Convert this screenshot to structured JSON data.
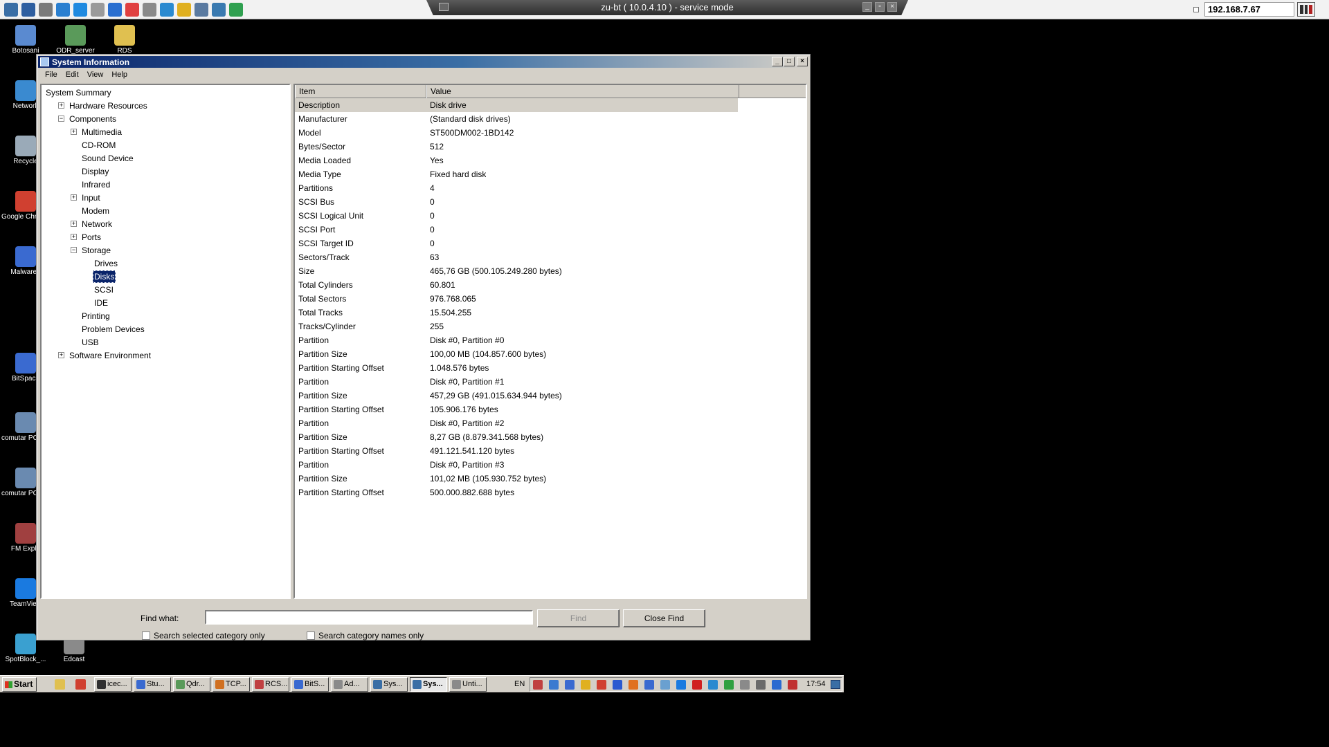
{
  "remote": {
    "title": "zu-bt ( 10.0.4.10 ) - service mode",
    "ip": "192.168.7.67",
    "tools": [
      {
        "icon": "settings-cogs-icon",
        "color": "#3a6ea5"
      },
      {
        "icon": "fullscreen-icon",
        "color": "#2f5fa0"
      },
      {
        "icon": "gear-icon",
        "color": "#7a7a7a"
      },
      {
        "icon": "refresh-icon",
        "color": "#2a7fd0"
      },
      {
        "icon": "windows-logo-icon",
        "color": "#1f8ae0"
      },
      {
        "icon": "document-icon",
        "color": "#9a9a9a"
      },
      {
        "icon": "info-icon",
        "color": "#2a6fd0"
      },
      {
        "icon": "close-circle-icon",
        "color": "#e04040"
      },
      {
        "icon": "clipboard-icon",
        "color": "#8a8a8a"
      },
      {
        "icon": "monitor-icon",
        "color": "#2a8ad0"
      },
      {
        "icon": "notes-icon",
        "color": "#e0b020"
      },
      {
        "icon": "screenshot-icon",
        "color": "#5a7aa0"
      },
      {
        "icon": "remote-settings-icon",
        "color": "#3a7ab0"
      },
      {
        "icon": "chat-icon",
        "color": "#30a050"
      }
    ]
  },
  "desktop": {
    "icons": [
      {
        "label": "Botosani",
        "color": "#5a8ad0"
      },
      {
        "label": "ODR_server",
        "color": "#5a9a5a"
      },
      {
        "label": "RDS",
        "color": "#e0c050"
      },
      {
        "label": "Network",
        "color": "#3a8ad0"
      },
      {
        "label": "Recycle",
        "color": "#9aaab8"
      },
      {
        "label": "Google Chrome",
        "color": "#d04030"
      },
      {
        "label": "Malwareb",
        "color": "#3a6ad0"
      },
      {
        "label": "BitSpace",
        "color": "#3a6ad0"
      },
      {
        "label": "comutar PC_OFF.b",
        "color": "#6a8ab0"
      },
      {
        "label": "comutar PC_ON.b",
        "color": "#6a8ab0"
      },
      {
        "label": "FM Explo",
        "color": "#a04040"
      },
      {
        "label": "TeamView",
        "color": "#1a7ae0"
      },
      {
        "label": "SpotBlock_...",
        "color": "#3aa0d0"
      },
      {
        "label": "Edcast",
        "color": "#8a8a8a"
      }
    ]
  },
  "window": {
    "title": "System Information",
    "menu": [
      "File",
      "Edit",
      "View",
      "Help"
    ],
    "tree": [
      {
        "label": "System Summary",
        "level": 0,
        "toggle": ""
      },
      {
        "label": "Hardware Resources",
        "level": 1,
        "toggle": "+"
      },
      {
        "label": "Components",
        "level": 1,
        "toggle": "−"
      },
      {
        "label": "Multimedia",
        "level": 2,
        "toggle": "+"
      },
      {
        "label": "CD-ROM",
        "level": 2,
        "toggle": ""
      },
      {
        "label": "Sound Device",
        "level": 2,
        "toggle": ""
      },
      {
        "label": "Display",
        "level": 2,
        "toggle": ""
      },
      {
        "label": "Infrared",
        "level": 2,
        "toggle": ""
      },
      {
        "label": "Input",
        "level": 2,
        "toggle": "+"
      },
      {
        "label": "Modem",
        "level": 2,
        "toggle": ""
      },
      {
        "label": "Network",
        "level": 2,
        "toggle": "+"
      },
      {
        "label": "Ports",
        "level": 2,
        "toggle": "+"
      },
      {
        "label": "Storage",
        "level": 2,
        "toggle": "−"
      },
      {
        "label": "Drives",
        "level": 3,
        "toggle": ""
      },
      {
        "label": "Disks",
        "level": 3,
        "toggle": "",
        "selected": true
      },
      {
        "label": "SCSI",
        "level": 3,
        "toggle": ""
      },
      {
        "label": "IDE",
        "level": 3,
        "toggle": ""
      },
      {
        "label": "Printing",
        "level": 2,
        "toggle": ""
      },
      {
        "label": "Problem Devices",
        "level": 2,
        "toggle": ""
      },
      {
        "label": "USB",
        "level": 2,
        "toggle": ""
      },
      {
        "label": "Software Environment",
        "level": 1,
        "toggle": "+"
      }
    ],
    "columns": {
      "item": "Item",
      "value": "Value"
    },
    "rows": [
      {
        "item": "Description",
        "value": "Disk drive"
      },
      {
        "item": "Manufacturer",
        "value": "(Standard disk drives)"
      },
      {
        "item": "Model",
        "value": "ST500DM002-1BD142"
      },
      {
        "item": "Bytes/Sector",
        "value": "512"
      },
      {
        "item": "Media Loaded",
        "value": "Yes"
      },
      {
        "item": "Media Type",
        "value": "Fixed hard disk"
      },
      {
        "item": "Partitions",
        "value": "4"
      },
      {
        "item": "SCSI Bus",
        "value": "0"
      },
      {
        "item": "SCSI Logical Unit",
        "value": "0"
      },
      {
        "item": "SCSI Port",
        "value": "0"
      },
      {
        "item": "SCSI Target ID",
        "value": "0"
      },
      {
        "item": "Sectors/Track",
        "value": "63"
      },
      {
        "item": "Size",
        "value": "465,76 GB (500.105.249.280 bytes)"
      },
      {
        "item": "Total Cylinders",
        "value": "60.801"
      },
      {
        "item": "Total Sectors",
        "value": "976.768.065"
      },
      {
        "item": "Total Tracks",
        "value": "15.504.255"
      },
      {
        "item": "Tracks/Cylinder",
        "value": "255"
      },
      {
        "item": "Partition",
        "value": "Disk #0, Partition #0"
      },
      {
        "item": "Partition Size",
        "value": "100,00 MB (104.857.600 bytes)"
      },
      {
        "item": "Partition Starting Offset",
        "value": "1.048.576 bytes"
      },
      {
        "item": "Partition",
        "value": "Disk #0, Partition #1"
      },
      {
        "item": "Partition Size",
        "value": "457,29 GB (491.015.634.944 bytes)"
      },
      {
        "item": "Partition Starting Offset",
        "value": "105.906.176 bytes"
      },
      {
        "item": "Partition",
        "value": "Disk #0, Partition #2"
      },
      {
        "item": "Partition Size",
        "value": "8,27 GB (8.879.341.568 bytes)"
      },
      {
        "item": "Partition Starting Offset",
        "value": "491.121.541.120 bytes"
      },
      {
        "item": "Partition",
        "value": "Disk #0, Partition #3"
      },
      {
        "item": "Partition Size",
        "value": "101,02 MB (105.930.752 bytes)"
      },
      {
        "item": "Partition Starting Offset",
        "value": "500.000.882.688 bytes"
      }
    ],
    "find": {
      "label": "Find what:",
      "value": "",
      "find_button": "Find",
      "close_find_button": "Close Find",
      "opt_selected": "Search selected category only",
      "opt_names": "Search category names only"
    }
  },
  "taskbar": {
    "start": "Start",
    "quick_launch": [
      {
        "icon": "folder-icon",
        "color": "#e0c050"
      },
      {
        "icon": "chrome-icon",
        "color": "#d04030"
      }
    ],
    "tasks": [
      {
        "label": "icec...",
        "color": "#303030"
      },
      {
        "label": "Stu...",
        "color": "#3a6ad0"
      },
      {
        "label": "Qdr...",
        "color": "#5a9a5a"
      },
      {
        "label": "TCP...",
        "color": "#d07020"
      },
      {
        "label": "RCS...",
        "color": "#c04040"
      },
      {
        "label": "BitS...",
        "color": "#3a6ad0"
      },
      {
        "label": "Ad...",
        "color": "#8a8a8a"
      },
      {
        "label": "Sys...",
        "color": "#3a6ea5"
      },
      {
        "label": "Sys...",
        "color": "#3a6ea5",
        "active": true
      },
      {
        "label": "Unti...",
        "color": "#8a8a8a"
      }
    ],
    "lang": "EN",
    "tray": [
      {
        "icon": "tray-sync-icon",
        "color": "#c04040"
      },
      {
        "icon": "tray-network-icon",
        "color": "#3a7ad0"
      },
      {
        "icon": "tray-user-icon",
        "color": "#3a6ad0"
      },
      {
        "icon": "tray-drive-icon",
        "color": "#e0b020"
      },
      {
        "icon": "tray-chrome-icon",
        "color": "#d04030"
      },
      {
        "icon": "tray-malwarebytes-icon",
        "color": "#2a5ad0"
      },
      {
        "icon": "tray-app-icon",
        "color": "#e07020"
      },
      {
        "icon": "tray-remote-icon",
        "color": "#3a6ad0"
      },
      {
        "icon": "tray-clipboard-icon",
        "color": "#6aa0d0"
      },
      {
        "icon": "tray-teamviewer-icon",
        "color": "#1a7ae0"
      },
      {
        "icon": "tray-media-icon",
        "color": "#d02020"
      },
      {
        "icon": "tray-messenger-icon",
        "color": "#2a8ad0"
      },
      {
        "icon": "tray-shield-icon",
        "color": "#30a040"
      },
      {
        "icon": "tray-volume-icon",
        "color": "#8a8a8a"
      },
      {
        "icon": "tray-printer-icon",
        "color": "#6a6a6a"
      },
      {
        "icon": "tray-tool-icon",
        "color": "#2a6ad0"
      },
      {
        "icon": "tray-security-icon",
        "color": "#c03030"
      }
    ],
    "clock": "17:54"
  }
}
